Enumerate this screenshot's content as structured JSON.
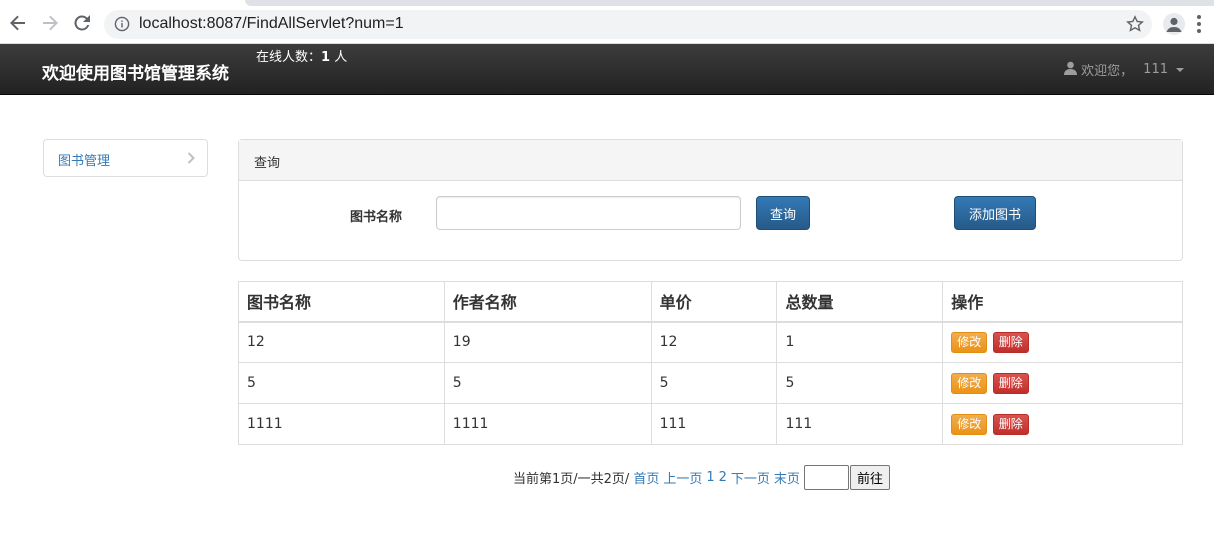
{
  "browser": {
    "url": "localhost:8087/FindAllServlet?num=1",
    "icons": [
      "back-arrow-icon",
      "forward-arrow-icon",
      "reload-icon",
      "info-icon",
      "star-icon",
      "profile-icon",
      "kebab-menu-icon"
    ]
  },
  "navbar": {
    "brand": "欢迎使用图书馆管理系统",
    "online_label": "在线人数：",
    "online_count": "1",
    "online_unit": "人",
    "welcome": "欢迎您，",
    "username": "111"
  },
  "sidebar": {
    "items": [
      {
        "label": "图书管理"
      }
    ]
  },
  "query_panel": {
    "heading": "查询",
    "field_label": "图书名称",
    "field_value": "",
    "query_button": "查询",
    "add_button": "添加图书"
  },
  "table": {
    "headers": [
      "图书名称",
      "作者名称",
      "单价",
      "总数量",
      "操作"
    ],
    "rows": [
      {
        "name": "12",
        "author": "19",
        "price": "12",
        "total": "1"
      },
      {
        "name": "5",
        "author": "5",
        "price": "5",
        "total": "5"
      },
      {
        "name": "1111",
        "author": "1111",
        "price": "111",
        "total": "111"
      }
    ],
    "edit_label": "修改",
    "delete_label": "删除"
  },
  "pagination": {
    "status": "当前第1页/一共2页/",
    "first": "首页",
    "prev": "上一页",
    "page1": "1",
    "page2": "2",
    "next": "下一页",
    "last": "末页",
    "goto_value": "",
    "goto_button": "前往"
  },
  "colors": {
    "navbar": "#222222",
    "link": "#337ab7",
    "primary": "#337ab7",
    "warning": "#f0ad4e",
    "danger": "#d9534f"
  }
}
